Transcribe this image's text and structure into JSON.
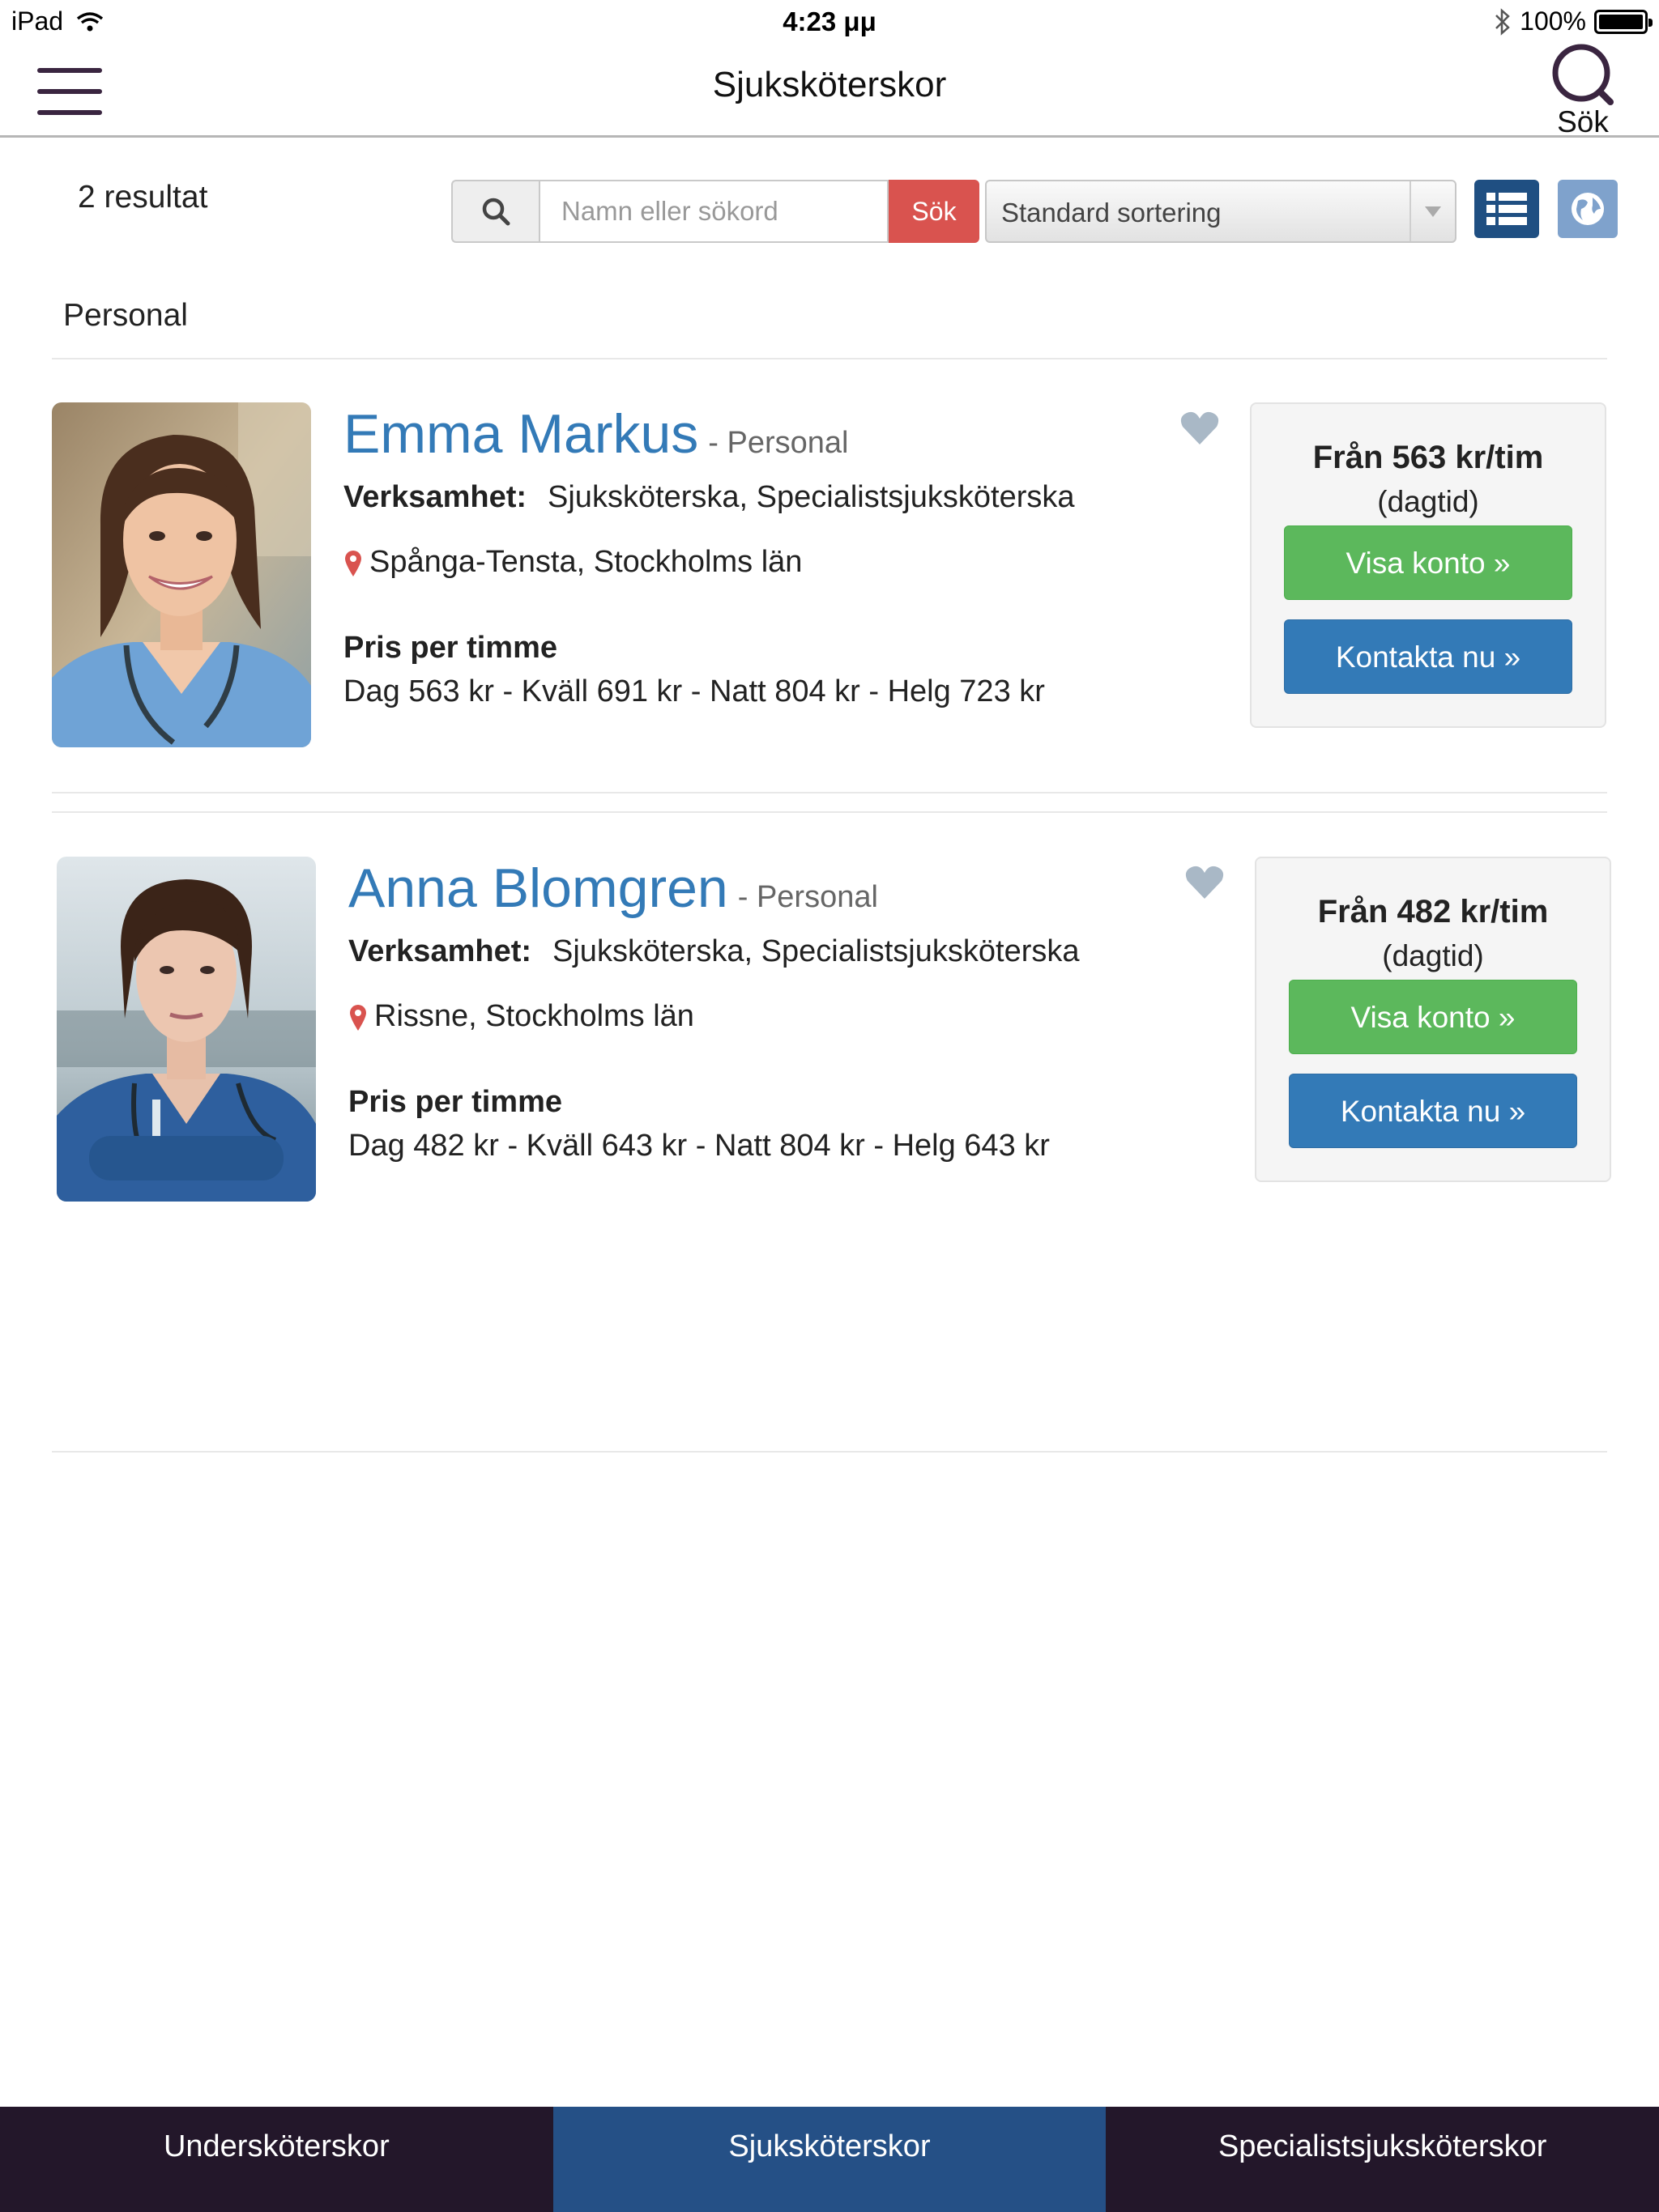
{
  "status_bar": {
    "device": "iPad",
    "time": "4:23 μμ",
    "battery": "100%",
    "battery_level": 1.0
  },
  "header": {
    "title": "Sjuksköterskor",
    "search_label": "Sök"
  },
  "toolbar": {
    "results": "2 resultat",
    "search_placeholder": "Namn eller sökord",
    "search_button": "Sök",
    "sort_value": "Standard sortering"
  },
  "section_label": "Personal",
  "listings": [
    {
      "name": "Emma Markus",
      "type": "- Personal",
      "verksamhet_label": "Verksamhet:",
      "verksamhet": "Sjuksköterska, Specialistsjuksköterska",
      "location": "Spånga-Tensta, Stockholms län",
      "price_heading": "Pris per timme",
      "prices": "Dag 563 kr - Kväll 691 kr - Natt 804 kr - Helg 723 kr",
      "from_price": "Från 563 kr/tim",
      "from_note": "(dagtid)",
      "view_button": "Visa konto »",
      "contact_button": "Kontakta nu »"
    },
    {
      "name": "Anna Blomgren",
      "type": "- Personal",
      "verksamhet_label": "Verksamhet:",
      "verksamhet": "Sjuksköterska, Specialistsjuksköterska",
      "location": "Rissne, Stockholms län",
      "price_heading": "Pris per timme",
      "prices": "Dag 482 kr - Kväll 643 kr - Natt 804 kr - Helg 643 kr",
      "from_price": "Från 482 kr/tim",
      "from_note": "(dagtid)",
      "view_button": "Visa konto »",
      "contact_button": "Kontakta nu »"
    }
  ],
  "tabs": [
    {
      "label": "Undersköterskor",
      "active": false
    },
    {
      "label": "Sjuksköterskor",
      "active": true
    },
    {
      "label": "Specialistsjuksköterskor",
      "active": false
    }
  ],
  "colors": {
    "link_blue": "#337ab7",
    "green": "#5cb85c",
    "red": "#d9534f",
    "tab_active": "#255086",
    "tab_bar": "#23172a"
  }
}
